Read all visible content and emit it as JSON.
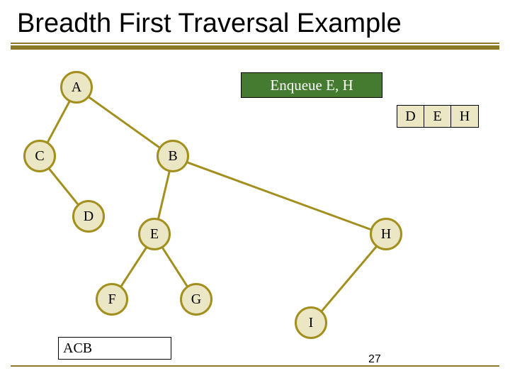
{
  "title": "Breadth First Traversal Example",
  "status_label": "Enqueue E, H",
  "queue": [
    "D",
    "E",
    "H"
  ],
  "visited": "ACB",
  "page_number": "27",
  "nodes": {
    "A": "A",
    "B": "B",
    "C": "C",
    "D": "D",
    "E": "E",
    "F": "F",
    "G": "G",
    "H": "H",
    "I": "I"
  },
  "colors": {
    "node_fill": "#EBE6C4",
    "node_border": "#A28F1D",
    "accent": "#8A7A27",
    "status_bg": "#457B30"
  }
}
